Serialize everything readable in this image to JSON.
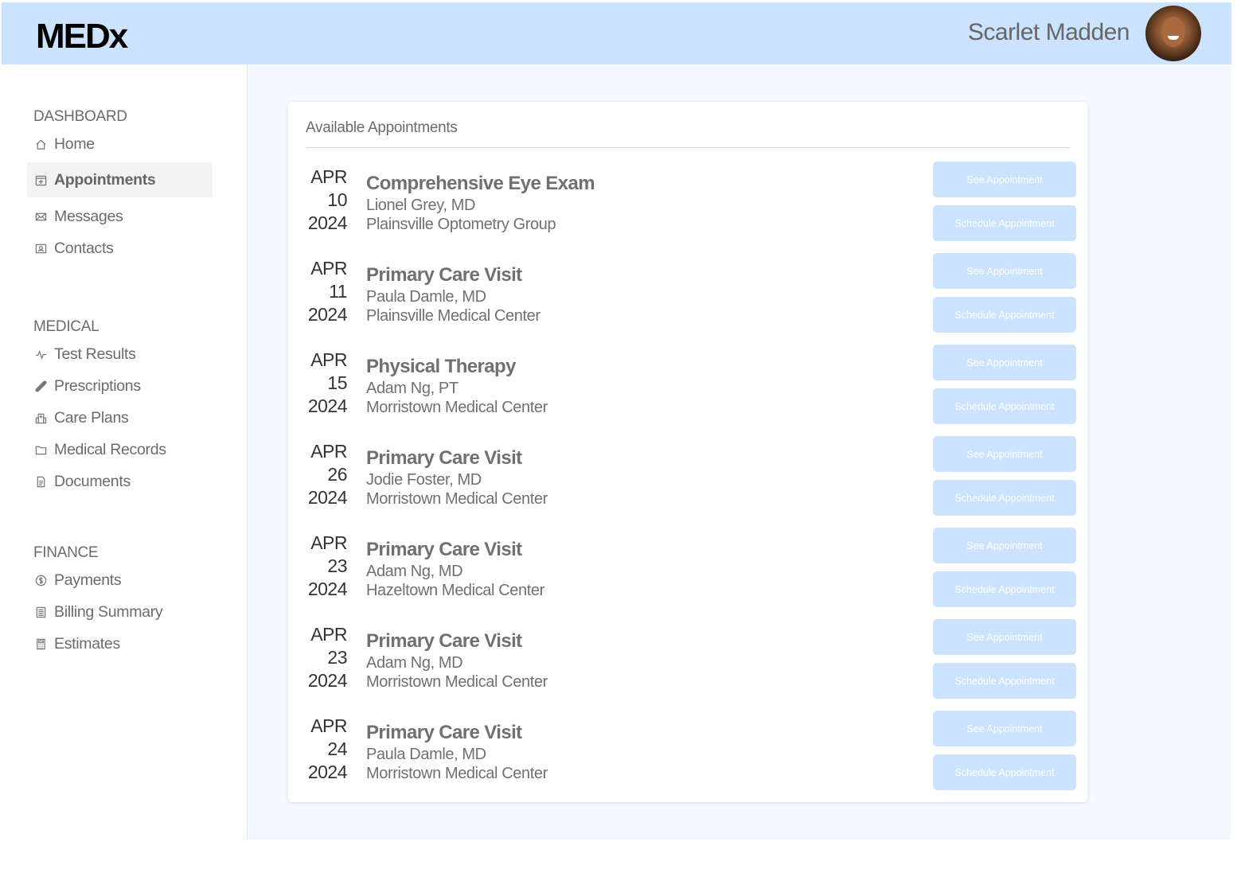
{
  "header": {
    "logo": "MEDx",
    "user_name": "Scarlet Madden",
    "bg_color": "#cce3ff"
  },
  "sidebar": {
    "sections": [
      {
        "title": "DASHBOARD",
        "items": [
          {
            "label": "Home",
            "icon": "home-icon"
          },
          {
            "label": "Appointments",
            "icon": "calendar-plus-icon",
            "active": true
          },
          {
            "label": "Messages",
            "icon": "envelope-icon"
          },
          {
            "label": "Contacts",
            "icon": "contact-card-icon"
          }
        ]
      },
      {
        "title": "MEDICAL",
        "items": [
          {
            "label": "Test Results",
            "icon": "pulse-icon"
          },
          {
            "label": "Prescriptions",
            "icon": "pill-icon"
          },
          {
            "label": "Care Plans",
            "icon": "hospital-icon"
          },
          {
            "label": "Medical Records",
            "icon": "folder-icon"
          },
          {
            "label": "Documents",
            "icon": "document-icon"
          }
        ]
      },
      {
        "title": "FINANCE",
        "items": [
          {
            "label": "Payments",
            "icon": "dollar-circle-icon"
          },
          {
            "label": "Billing Summary",
            "icon": "list-icon"
          },
          {
            "label": "Estimates",
            "icon": "calculator-icon"
          }
        ]
      }
    ]
  },
  "main": {
    "card_title": "Available Appointments",
    "see_label": "See Appointment",
    "schedule_label": "Schedule Appointment",
    "button_color": "#cce3ff",
    "appointments": [
      {
        "month": "APR",
        "day": "10",
        "year": "2024",
        "title": "Comprehensive Eye Exam",
        "provider": "Lionel Grey, MD",
        "location": "Plainsville Optometry Group"
      },
      {
        "month": "APR",
        "day": "11",
        "year": "2024",
        "title": "Primary Care Visit",
        "provider": "Paula Damle, MD",
        "location": "Plainsville Medical Center"
      },
      {
        "month": "APR",
        "day": "15",
        "year": "2024",
        "title": "Physical Therapy",
        "provider": "Adam Ng, PT",
        "location": "Morristown Medical Center"
      },
      {
        "month": "APR",
        "day": "26",
        "year": "2024",
        "title": "Primary Care Visit",
        "provider": "Jodie Foster, MD",
        "location": "Morristown Medical Center"
      },
      {
        "month": "APR",
        "day": "23",
        "year": "2024",
        "title": "Primary Care Visit",
        "provider": "Adam Ng, MD",
        "location": "Hazeltown Medical Center"
      },
      {
        "month": "APR",
        "day": "23",
        "year": "2024",
        "title": "Primary Care Visit",
        "provider": "Adam Ng, MD",
        "location": "Morristown Medical Center"
      },
      {
        "month": "APR",
        "day": "24",
        "year": "2024",
        "title": "Primary Care Visit",
        "provider": "Paula Damle, MD",
        "location": "Morristown Medical Center"
      }
    ]
  }
}
